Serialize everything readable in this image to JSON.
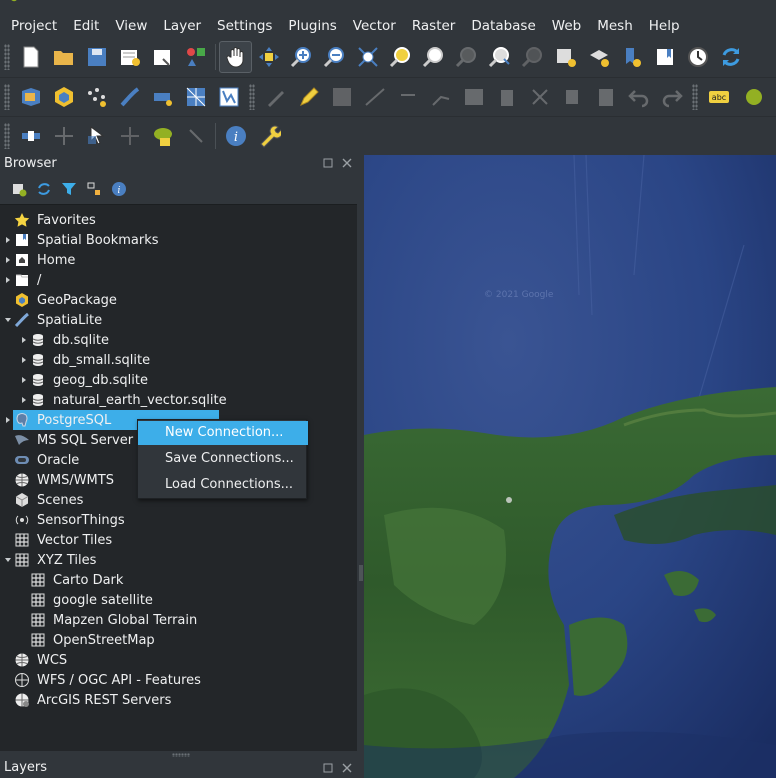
{
  "menubar": {
    "items": [
      "Project",
      "Edit",
      "View",
      "Layer",
      "Settings",
      "Plugins",
      "Vector",
      "Raster",
      "Database",
      "Web",
      "Mesh",
      "Help"
    ]
  },
  "browser": {
    "title": "Browser",
    "tree": [
      {
        "label": "Favorites",
        "icon": "star-icon",
        "arrow": "",
        "indent": 0
      },
      {
        "label": "Spatial Bookmarks",
        "icon": "bookmark-icon",
        "arrow": "collapsed",
        "indent": 0
      },
      {
        "label": "Home",
        "icon": "home-folder-icon",
        "arrow": "collapsed",
        "indent": 0
      },
      {
        "label": "/",
        "icon": "folder-icon",
        "arrow": "collapsed",
        "indent": 0
      },
      {
        "label": "GeoPackage",
        "icon": "geopackage-icon",
        "arrow": "",
        "indent": 0
      },
      {
        "label": "SpatiaLite",
        "icon": "spatialite-icon",
        "arrow": "expanded",
        "indent": 0
      },
      {
        "label": "db.sqlite",
        "icon": "database-icon",
        "arrow": "collapsed",
        "indent": 1
      },
      {
        "label": "db_small.sqlite",
        "icon": "database-icon",
        "arrow": "collapsed",
        "indent": 1
      },
      {
        "label": "geog_db.sqlite",
        "icon": "database-icon",
        "arrow": "collapsed",
        "indent": 1
      },
      {
        "label": "natural_earth_vector.sqlite",
        "icon": "database-icon",
        "arrow": "collapsed",
        "indent": 1
      },
      {
        "label": "PostgreSQL",
        "icon": "postgresql-icon",
        "arrow": "collapsed",
        "indent": 0,
        "selected": true
      },
      {
        "label": "MS SQL Server",
        "icon": "mssql-icon",
        "arrow": "",
        "indent": 0
      },
      {
        "label": "Oracle",
        "icon": "oracle-icon",
        "arrow": "",
        "indent": 0
      },
      {
        "label": "WMS/WMTS",
        "icon": "globe-icon",
        "arrow": "",
        "indent": 0
      },
      {
        "label": "Scenes",
        "icon": "scenes-icon",
        "arrow": "",
        "indent": 0
      },
      {
        "label": "SensorThings",
        "icon": "sensor-icon",
        "arrow": "",
        "indent": 0
      },
      {
        "label": "Vector Tiles",
        "icon": "grid-icon",
        "arrow": "",
        "indent": 0
      },
      {
        "label": "XYZ Tiles",
        "icon": "grid-icon",
        "arrow": "expanded",
        "indent": 0
      },
      {
        "label": "Carto Dark",
        "icon": "grid-icon",
        "arrow": "",
        "indent": 1
      },
      {
        "label": "google satellite",
        "icon": "grid-icon",
        "arrow": "",
        "indent": 1
      },
      {
        "label": "Mapzen Global Terrain",
        "icon": "grid-icon",
        "arrow": "",
        "indent": 1
      },
      {
        "label": "OpenStreetMap",
        "icon": "grid-icon",
        "arrow": "",
        "indent": 1
      },
      {
        "label": "WCS",
        "icon": "globe-icon",
        "arrow": "",
        "indent": 0
      },
      {
        "label": "WFS / OGC API - Features",
        "icon": "globe-outline-icon",
        "arrow": "",
        "indent": 0
      },
      {
        "label": "ArcGIS REST Servers",
        "icon": "arcgis-icon",
        "arrow": "",
        "indent": 0
      }
    ]
  },
  "context_menu": {
    "items": [
      {
        "label": "New Connection...",
        "highlighted": true
      },
      {
        "label": "Save Connections...",
        "highlighted": false
      },
      {
        "label": "Load Connections...",
        "highlighted": false
      }
    ]
  },
  "layers": {
    "title": "Layers"
  },
  "map": {
    "watermark": "© 2021 Google"
  },
  "colors": {
    "accent": "#3daee9",
    "panel_bg": "#31363b",
    "tree_bg": "#232629"
  }
}
